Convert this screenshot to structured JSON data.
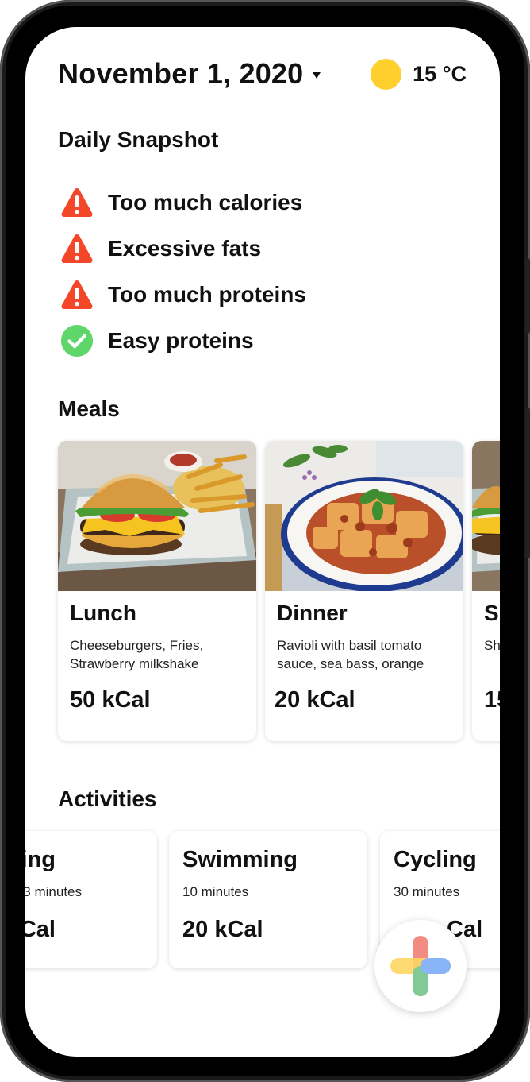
{
  "header": {
    "date": "November 1, 2020",
    "temperature": "15 °C",
    "weather_icon": "sun-icon",
    "sun_color": "#FFCF2E"
  },
  "snapshot": {
    "title": "Daily Snapshot",
    "items": [
      {
        "label": "Too much calories",
        "status": "warning",
        "icon": "warning-icon"
      },
      {
        "label": "Excessive fats",
        "status": "warning",
        "icon": "warning-icon"
      },
      {
        "label": "Too much proteins",
        "status": "warning",
        "icon": "warning-icon"
      },
      {
        "label": "Easy proteins",
        "status": "ok",
        "icon": "check-circle-icon"
      }
    ],
    "colors": {
      "warning": "#F4472A",
      "ok": "#5ED66A"
    }
  },
  "meals": {
    "title": "Meals",
    "items": [
      {
        "name": "Lunch",
        "description": "Cheeseburgers, Fries, Strawberry milkshake",
        "calories": "50 kCal",
        "image": "burger-fries-photo"
      },
      {
        "name": "Dinner",
        "description": "Ravioli with basil tomato sauce, sea bass, orange",
        "calories": "20 kCal",
        "image": "ravioli-photo"
      },
      {
        "name": "S",
        "description": "Sh",
        "calories": "15",
        "image": "burger-photo"
      }
    ]
  },
  "activities": {
    "title": "Activities",
    "items": [
      {
        "name": "ing",
        "duration": "3 minutes",
        "calories": "Cal"
      },
      {
        "name": "Swimming",
        "duration": "10 minutes",
        "calories": "20 kCal"
      },
      {
        "name": "Cycling",
        "duration": "30 minutes",
        "calories": "Cal"
      }
    ]
  },
  "fab": {
    "icon": "add-icon",
    "colors": [
      "#F28B82",
      "#FDD663",
      "#81C995",
      "#8AB4F8"
    ]
  }
}
